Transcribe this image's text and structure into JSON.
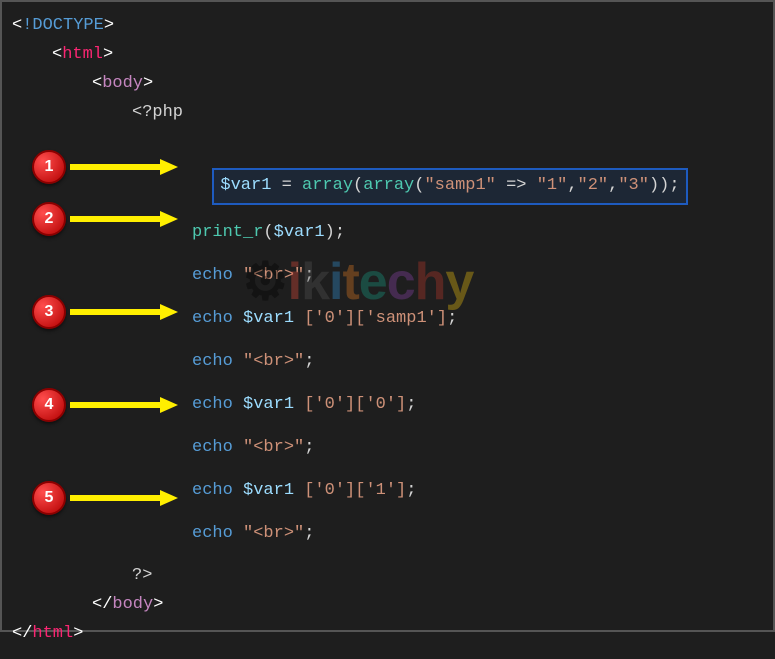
{
  "code": {
    "doctype_open": "<",
    "doctype_text": "!DOCTYPE",
    "doctype_close": ">",
    "html_open": "<html>",
    "body_open": "<body>",
    "php_open": "<?php",
    "l1_var": "$var1",
    "l1_eq": " = ",
    "l1_array1": "array",
    "l1_p1": "(",
    "l1_array2": "array",
    "l1_p2": "(",
    "l1_s1": "\"samp1\"",
    "l1_arrow": " => ",
    "l1_s2": "\"1\"",
    "l1_c1": ",",
    "l1_s3": "\"2\"",
    "l1_c2": ",",
    "l1_s4": "\"3\"",
    "l1_p3": "));",
    "l2_func": "print_r",
    "l2_p1": "(",
    "l2_var": "$var1",
    "l2_p2": ");",
    "echo_kw": "echo ",
    "br_str": "\"<br>\"",
    "semi": ";",
    "l3_var": "$var1 ",
    "l3_idx": "['0']['samp1']",
    "l4_var": "$var1 ",
    "l4_idx": "['0']['0']",
    "l5_var": "$var1 ",
    "l5_idx": "['0']['1']",
    "php_close": "?>",
    "body_close": "</body>",
    "html_close": "</html>"
  },
  "callouts": [
    "1",
    "2",
    "3",
    "4",
    "5"
  ],
  "watermark": {
    "text": "Wikitechy"
  }
}
